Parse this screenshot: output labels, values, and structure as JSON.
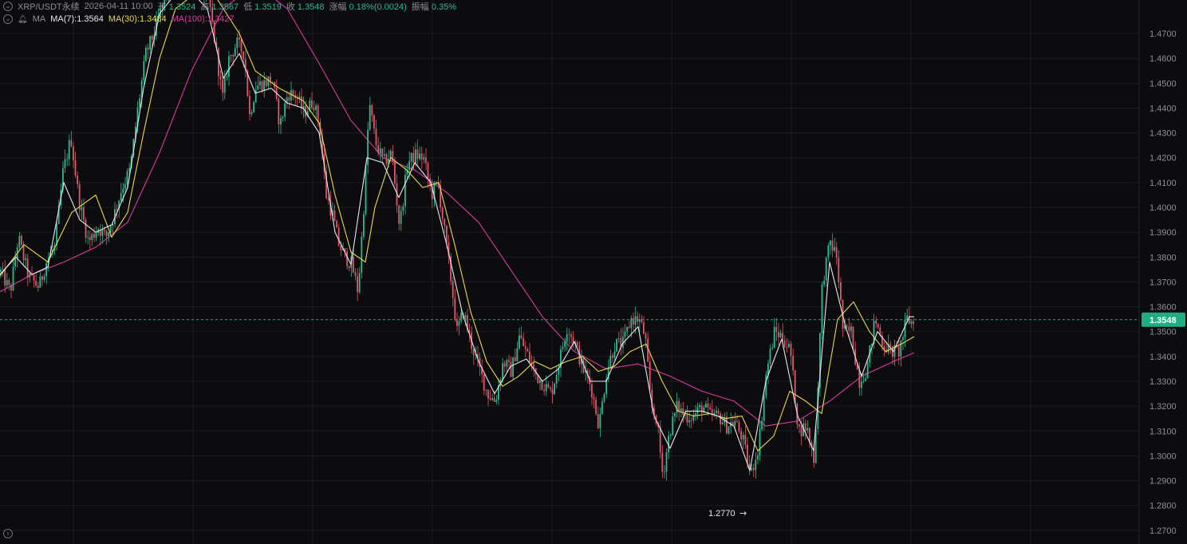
{
  "header": {
    "symbol": "XRP/USDT永续",
    "time": "2026-04-11 10:00",
    "open_label": "开",
    "open": "1.3524",
    "high_label": "高",
    "high": "1.3567",
    "low_label": "低",
    "low": "1.3519",
    "close_label": "收",
    "close": "1.3548",
    "change_label": "涨幅",
    "change": "0.18%(0.0024)",
    "amp_label": "振幅",
    "amp": "0.35%",
    "ma_label": "MA",
    "ma7": "MA(7):1.3564",
    "ma30": "MA(30):1.3484",
    "ma100": "MA(100):1.3427"
  },
  "colors": {
    "up": "#2dbb8f",
    "down": "#e0566d",
    "ma7": "#e6e8eb",
    "ma30": "#e9d84a",
    "ma100": "#d93aa1",
    "price_tag": "#1fae84",
    "background": "#0c0c0e",
    "grid": "#1b1d21"
  },
  "chart_data": {
    "type": "candlestick",
    "ylim": [
      1.2645,
      1.4835
    ],
    "y_ticks": [
      "1.4700",
      "1.4600",
      "1.4500",
      "1.4400",
      "1.4300",
      "1.4200",
      "1.4100",
      "1.4000",
      "1.3900",
      "1.3800",
      "1.3700",
      "1.3600",
      "1.3500",
      "1.3400",
      "1.3300",
      "1.3200",
      "1.3100",
      "1.3000",
      "1.2900",
      "1.2800",
      "1.2700"
    ],
    "current_price": "1.3548",
    "low_marker": "1.2770",
    "grid": true,
    "close_path": [
      [
        0,
        1.374
      ],
      [
        12,
        1.366
      ],
      [
        22,
        1.388
      ],
      [
        35,
        1.372
      ],
      [
        48,
        1.368
      ],
      [
        58,
        1.379
      ],
      [
        68,
        1.384
      ],
      [
        78,
        1.414
      ],
      [
        88,
        1.428
      ],
      [
        98,
        1.403
      ],
      [
        110,
        1.386
      ],
      [
        122,
        1.392
      ],
      [
        132,
        1.388
      ],
      [
        142,
        1.397
      ],
      [
        152,
        1.408
      ],
      [
        162,
        1.415
      ],
      [
        172,
        1.44
      ],
      [
        182,
        1.462
      ],
      [
        192,
        1.47
      ],
      [
        200,
        1.478
      ],
      [
        210,
        1.49
      ],
      [
        222,
        1.49
      ],
      [
        235,
        1.49
      ],
      [
        250,
        1.49
      ],
      [
        262,
        1.481
      ],
      [
        270,
        1.463
      ],
      [
        278,
        1.444
      ],
      [
        286,
        1.46
      ],
      [
        296,
        1.466
      ],
      [
        305,
        1.462
      ],
      [
        312,
        1.437
      ],
      [
        320,
        1.449
      ],
      [
        330,
        1.45
      ],
      [
        340,
        1.452
      ],
      [
        350,
        1.433
      ],
      [
        360,
        1.446
      ],
      [
        370,
        1.445
      ],
      [
        380,
        1.438
      ],
      [
        392,
        1.443
      ],
      [
        400,
        1.432
      ],
      [
        408,
        1.405
      ],
      [
        416,
        1.397
      ],
      [
        424,
        1.385
      ],
      [
        432,
        1.38
      ],
      [
        440,
        1.377
      ],
      [
        448,
        1.366
      ],
      [
        456,
        1.405
      ],
      [
        462,
        1.442
      ],
      [
        470,
        1.426
      ],
      [
        480,
        1.418
      ],
      [
        490,
        1.422
      ],
      [
        500,
        1.392
      ],
      [
        510,
        1.418
      ],
      [
        520,
        1.421
      ],
      [
        530,
        1.42
      ],
      [
        540,
        1.405
      ],
      [
        548,
        1.41
      ],
      [
        556,
        1.391
      ],
      [
        564,
        1.372
      ],
      [
        572,
        1.35
      ],
      [
        580,
        1.358
      ],
      [
        590,
        1.345
      ],
      [
        600,
        1.335
      ],
      [
        610,
        1.325
      ],
      [
        620,
        1.322
      ],
      [
        630,
        1.338
      ],
      [
        640,
        1.334
      ],
      [
        650,
        1.348
      ],
      [
        660,
        1.341
      ],
      [
        670,
        1.333
      ],
      [
        680,
        1.329
      ],
      [
        690,
        1.325
      ],
      [
        700,
        1.338
      ],
      [
        710,
        1.352
      ],
      [
        720,
        1.345
      ],
      [
        730,
        1.335
      ],
      [
        740,
        1.328
      ],
      [
        750,
        1.312
      ],
      [
        760,
        1.335
      ],
      [
        770,
        1.345
      ],
      [
        780,
        1.345
      ],
      [
        790,
        1.355
      ],
      [
        800,
        1.355
      ],
      [
        808,
        1.348
      ],
      [
        815,
        1.32
      ],
      [
        822,
        1.315
      ],
      [
        830,
        1.292
      ],
      [
        838,
        1.309
      ],
      [
        848,
        1.32
      ],
      [
        858,
        1.316
      ],
      [
        868,
        1.316
      ],
      [
        880,
        1.32
      ],
      [
        890,
        1.316
      ],
      [
        900,
        1.316
      ],
      [
        910,
        1.312
      ],
      [
        920,
        1.314
      ],
      [
        930,
        1.307
      ],
      [
        940,
        1.292
      ],
      [
        950,
        1.304
      ],
      [
        960,
        1.334
      ],
      [
        970,
        1.35
      ],
      [
        980,
        1.348
      ],
      [
        990,
        1.342
      ],
      [
        1000,
        1.31
      ],
      [
        1010,
        1.312
      ],
      [
        1020,
        1.298
      ],
      [
        1030,
        1.37
      ],
      [
        1040,
        1.386
      ],
      [
        1048,
        1.38
      ],
      [
        1056,
        1.35
      ],
      [
        1066,
        1.35
      ],
      [
        1076,
        1.33
      ],
      [
        1086,
        1.335
      ],
      [
        1096,
        1.355
      ],
      [
        1106,
        1.345
      ],
      [
        1116,
        1.342
      ],
      [
        1126,
        1.342
      ],
      [
        1136,
        1.355
      ],
      [
        1146,
        1.353
      ]
    ],
    "ma7": [
      [
        0,
        1.373
      ],
      [
        20,
        1.38
      ],
      [
        40,
        1.373
      ],
      [
        60,
        1.376
      ],
      [
        80,
        1.41
      ],
      [
        100,
        1.395
      ],
      [
        120,
        1.39
      ],
      [
        140,
        1.393
      ],
      [
        160,
        1.408
      ],
      [
        180,
        1.448
      ],
      [
        200,
        1.478
      ],
      [
        230,
        1.49
      ],
      [
        260,
        1.48
      ],
      [
        280,
        1.452
      ],
      [
        300,
        1.462
      ],
      [
        320,
        1.446
      ],
      [
        340,
        1.448
      ],
      [
        360,
        1.442
      ],
      [
        380,
        1.44
      ],
      [
        400,
        1.43
      ],
      [
        420,
        1.39
      ],
      [
        440,
        1.377
      ],
      [
        460,
        1.42
      ],
      [
        480,
        1.418
      ],
      [
        500,
        1.404
      ],
      [
        520,
        1.418
      ],
      [
        540,
        1.41
      ],
      [
        560,
        1.385
      ],
      [
        580,
        1.357
      ],
      [
        600,
        1.338
      ],
      [
        620,
        1.325
      ],
      [
        640,
        1.336
      ],
      [
        660,
        1.339
      ],
      [
        680,
        1.33
      ],
      [
        700,
        1.335
      ],
      [
        720,
        1.346
      ],
      [
        740,
        1.33
      ],
      [
        760,
        1.33
      ],
      [
        780,
        1.345
      ],
      [
        800,
        1.352
      ],
      [
        820,
        1.316
      ],
      [
        840,
        1.303
      ],
      [
        860,
        1.318
      ],
      [
        880,
        1.318
      ],
      [
        900,
        1.316
      ],
      [
        920,
        1.312
      ],
      [
        940,
        1.294
      ],
      [
        960,
        1.33
      ],
      [
        980,
        1.347
      ],
      [
        1000,
        1.316
      ],
      [
        1020,
        1.302
      ],
      [
        1040,
        1.378
      ],
      [
        1060,
        1.352
      ],
      [
        1080,
        1.332
      ],
      [
        1100,
        1.35
      ],
      [
        1120,
        1.342
      ],
      [
        1140,
        1.356
      ],
      [
        1146,
        1.356
      ]
    ],
    "ma30": [
      [
        0,
        1.3725
      ],
      [
        30,
        1.385
      ],
      [
        60,
        1.378
      ],
      [
        90,
        1.398
      ],
      [
        120,
        1.405
      ],
      [
        140,
        1.388
      ],
      [
        160,
        1.398
      ],
      [
        180,
        1.43
      ],
      [
        200,
        1.46
      ],
      [
        220,
        1.48
      ],
      [
        260,
        1.49
      ],
      [
        300,
        1.47
      ],
      [
        320,
        1.455
      ],
      [
        350,
        1.448
      ],
      [
        380,
        1.443
      ],
      [
        400,
        1.434
      ],
      [
        420,
        1.405
      ],
      [
        440,
        1.382
      ],
      [
        458,
        1.378
      ],
      [
        470,
        1.4
      ],
      [
        490,
        1.42
      ],
      [
        510,
        1.415
      ],
      [
        530,
        1.408
      ],
      [
        550,
        1.41
      ],
      [
        570,
        1.385
      ],
      [
        590,
        1.358
      ],
      [
        610,
        1.338
      ],
      [
        630,
        1.328
      ],
      [
        650,
        1.332
      ],
      [
        670,
        1.338
      ],
      [
        690,
        1.335
      ],
      [
        710,
        1.338
      ],
      [
        730,
        1.34
      ],
      [
        750,
        1.334
      ],
      [
        770,
        1.336
      ],
      [
        790,
        1.342
      ],
      [
        810,
        1.345
      ],
      [
        830,
        1.33
      ],
      [
        850,
        1.318
      ],
      [
        870,
        1.316
      ],
      [
        890,
        1.317
      ],
      [
        910,
        1.315
      ],
      [
        930,
        1.316
      ],
      [
        950,
        1.302
      ],
      [
        970,
        1.308
      ],
      [
        990,
        1.326
      ],
      [
        1010,
        1.322
      ],
      [
        1030,
        1.317
      ],
      [
        1050,
        1.355
      ],
      [
        1070,
        1.362
      ],
      [
        1090,
        1.35
      ],
      [
        1110,
        1.342
      ],
      [
        1130,
        1.345
      ],
      [
        1146,
        1.348
      ]
    ],
    "ma100": [
      [
        0,
        1.366
      ],
      [
        40,
        1.373
      ],
      [
        80,
        1.378
      ],
      [
        120,
        1.384
      ],
      [
        160,
        1.394
      ],
      [
        200,
        1.422
      ],
      [
        240,
        1.455
      ],
      [
        280,
        1.48
      ],
      [
        320,
        1.49
      ],
      [
        360,
        1.48
      ],
      [
        400,
        1.458
      ],
      [
        440,
        1.435
      ],
      [
        480,
        1.42
      ],
      [
        520,
        1.415
      ],
      [
        560,
        1.406
      ],
      [
        600,
        1.394
      ],
      [
        640,
        1.375
      ],
      [
        680,
        1.356
      ],
      [
        720,
        1.342
      ],
      [
        760,
        1.335
      ],
      [
        800,
        1.337
      ],
      [
        840,
        1.332
      ],
      [
        880,
        1.326
      ],
      [
        920,
        1.322
      ],
      [
        960,
        1.312
      ],
      [
        1000,
        1.314
      ],
      [
        1040,
        1.322
      ],
      [
        1080,
        1.332
      ],
      [
        1120,
        1.338
      ],
      [
        1146,
        1.3415
      ]
    ]
  }
}
